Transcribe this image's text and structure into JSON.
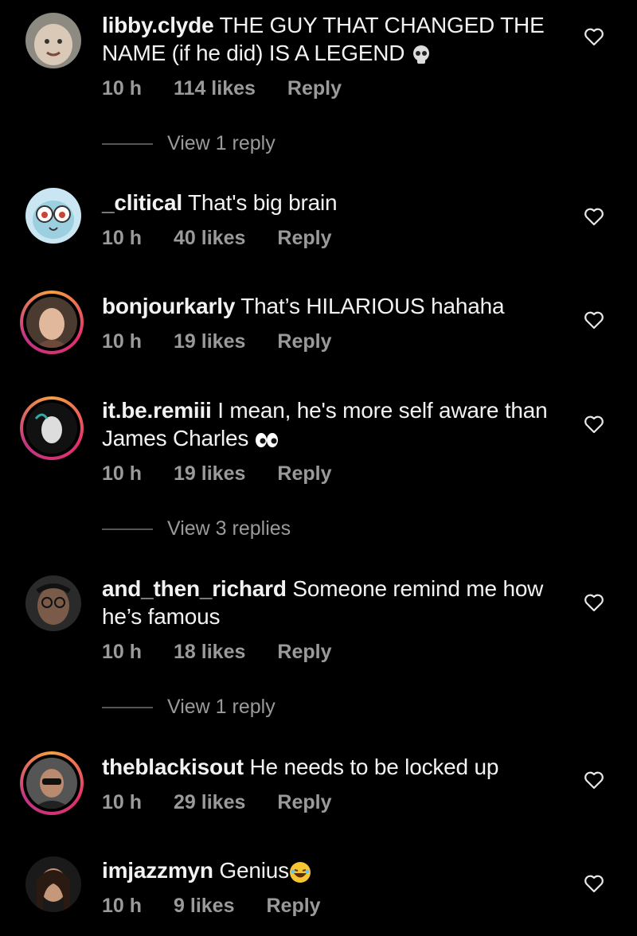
{
  "comments": [
    {
      "username": "libby.clyde",
      "text": "THE GUY THAT CHANGED THE NAME (if he did) IS A LEGEND",
      "emoji": "skull",
      "time": "10 h",
      "likes": "114 likes",
      "reply": "Reply",
      "view_replies": "View 1 reply"
    },
    {
      "username": "_clitical",
      "text": "That's big brain",
      "time": "10 h",
      "likes": "40 likes",
      "reply": "Reply"
    },
    {
      "username": "bonjourkarly",
      "text": "That’s HILARIOUS hahaha",
      "time": "10 h",
      "likes": "19 likes",
      "reply": "Reply"
    },
    {
      "username": "it.be.remiii",
      "text": "I  mean, he's more self aware than James Charles",
      "emoji": "eyes",
      "time": "10 h",
      "likes": "19 likes",
      "reply": "Reply",
      "view_replies": "View 3 replies"
    },
    {
      "username": "and_then_richard",
      "text": "Someone remind me how he’s famous",
      "time": "10 h",
      "likes": "18 likes",
      "reply": "Reply",
      "view_replies": "View 1 reply"
    },
    {
      "username": "theblackisout",
      "text": "He needs to be locked up",
      "time": "10 h",
      "likes": "29 likes",
      "reply": "Reply"
    },
    {
      "username": "imjazzmyn",
      "text": "Genius",
      "emoji": "laughing-face",
      "time": "10 h",
      "likes": "9 likes",
      "reply": "Reply"
    }
  ],
  "icons": {
    "like": "heart-outline-icon"
  },
  "colors": {
    "background": "#000000",
    "text": "#f2f2f2",
    "secondary": "#9a9a9a",
    "story_ring": "#e1306c"
  }
}
